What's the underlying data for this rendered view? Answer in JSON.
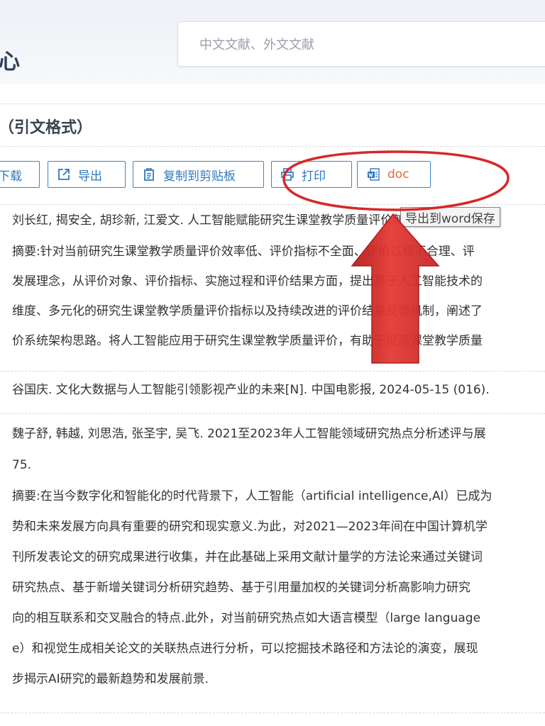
{
  "header": {
    "title_fragment": "心",
    "search_placeholder": "中文文献、外文文献"
  },
  "section_title": "（引文格式）",
  "toolbar": {
    "download_label": "下载",
    "export_label": "导出",
    "copy_label": "复制到剪贴板",
    "print_label": "打印",
    "doc_label": "doc"
  },
  "tooltip": "导出到word保存",
  "colors": {
    "button_border": "#3a86c8",
    "button_text": "#2f78bd",
    "doc_text": "#e06a3a",
    "annotation_red": "#d62828"
  },
  "items": [
    {
      "citation": "刘长红, 揭安全, 胡珍新, 江爱文. 人工智能赋能研究生课堂教学质量评价新模式[J]. 软件导",
      "abstract_lines": [
        "摘要:针对当前研究生课堂教学质量评价效率低、评价指标不全面、评价过程不合理、评",
        "发展理念，从评价对象、评价指标、实施过程和评价结果方面，提出基于人工智能技术的",
        "维度、多元化的研究生课堂教学质量评价指标以及持续改进的评价结果反馈机制，阐述了",
        "价系统架构思路。将人工智能应用于研究生课堂教学质量评价，有助于提高课堂教学质量"
      ]
    },
    {
      "citation": "谷国庆. 文化大数据与人工智能引领影视产业的未来[N]. 中国电影报, 2024-05-15 (016).",
      "abstract_lines": []
    },
    {
      "citation": "魏子舒, 韩越, 刘思浩, 张圣宇, 吴飞. 2021至2023年人工智能领域研究热点分析述评与展",
      "citation_cont": "75.",
      "abstract_lines": [
        "摘要:在当今数字化和智能化的时代背景下，人工智能（artificial intelligence,AI）已成为",
        "势和未来发展方向具有重要的研究和现实意义.为此，对2021—2023年间在中国计算机学",
        "刊所发表论文的研究成果进行收集，并在此基础上采用文献计量学的方法论来通过关键词",
        "研究热点、基于新增关键词分析研究趋势、基于引用量加权的关键词分析高影响力研究",
        "向的相互联系和交叉融合的特点.此外，对当前研究热点如大语言模型（large language",
        "e）和视觉生成相关论文的关联热点进行分析，可以挖掘技术路径和方法论的演变，展现",
        "步揭示AI研究的最新趋势和发展前景."
      ]
    }
  ]
}
